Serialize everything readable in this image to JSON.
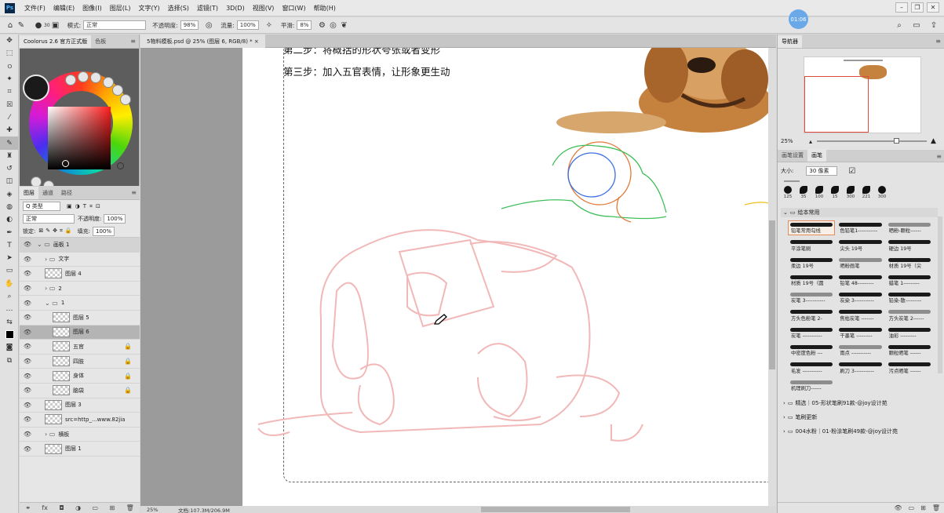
{
  "menu": {
    "logo": "Ps",
    "items": [
      "文件(F)",
      "编辑(E)",
      "图像(I)",
      "图层(L)",
      "文字(Y)",
      "选择(S)",
      "滤镜(T)",
      "3D(D)",
      "视图(V)",
      "窗口(W)",
      "帮助(H)"
    ]
  },
  "timer": "01:06",
  "options": {
    "brush_size": "30",
    "mode_label": "模式:",
    "mode_value": "正常",
    "opacity_label": "不透明度:",
    "opacity_value": "98%",
    "flow_label": "流量:",
    "flow_value": "100%",
    "smooth_label": "平滑:",
    "smooth_value": "8%"
  },
  "left_panel": {
    "tabs": [
      "Coolorus 2.6 官方正式版",
      "色板"
    ],
    "layer_tabs": [
      "图层",
      "通道",
      "路径"
    ],
    "filter_kind": "Q 类型",
    "blend_mode": "正常",
    "opacity_label": "不透明度:",
    "opacity_value": "100%",
    "lock_label": "锁定:",
    "fill_label": "填充:",
    "fill_value": "100%",
    "layers": [
      {
        "name": "画板 1",
        "type": "artboard",
        "indent": 0
      },
      {
        "name": "文字",
        "type": "group",
        "indent": 1
      },
      {
        "name": "图层 4",
        "type": "layer",
        "indent": 1
      },
      {
        "name": "2",
        "type": "group",
        "indent": 1
      },
      {
        "name": "1",
        "type": "group-open",
        "indent": 1
      },
      {
        "name": "图层 5",
        "type": "layer",
        "indent": 2
      },
      {
        "name": "图层 6",
        "type": "layer",
        "indent": 2,
        "selected": true
      },
      {
        "name": "五官",
        "type": "layer",
        "indent": 2,
        "locked": true
      },
      {
        "name": "四肢",
        "type": "layer",
        "indent": 2,
        "locked": true
      },
      {
        "name": "身体",
        "type": "layer",
        "indent": 2,
        "locked": true
      },
      {
        "name": "脑袋",
        "type": "layer",
        "indent": 2,
        "locked": true
      },
      {
        "name": "图层 3",
        "type": "layer",
        "indent": 1
      },
      {
        "name": "src=http_...www.82jia",
        "type": "layer",
        "indent": 1
      },
      {
        "name": "横板",
        "type": "group",
        "indent": 1
      },
      {
        "name": "图层 1",
        "type": "layer",
        "indent": 1
      }
    ]
  },
  "document": {
    "tab_title": "5物料模板.psd @ 25% (图层 6, RGB/8) * ×",
    "step2_text": "第二步：将概括的形状夸张或者变形",
    "step3_text": "第三步：加入五官表情，让形象更生动",
    "zoom": "25%",
    "doc_info": "文档:107.3M/206.9M"
  },
  "right_panel": {
    "navigator_tab": "导航器",
    "nav_zoom": "25%",
    "brush_tabs": [
      "画笔设置",
      "画笔"
    ],
    "size_label": "大小:",
    "size_value": "30 像素",
    "presets": [
      "125",
      "35",
      "100",
      "15",
      "300",
      "221",
      "300"
    ],
    "group_name": "绘本常用",
    "brushes": [
      "铅笔常用勾线",
      "色铅笔1-----------",
      "晒粉-颗粒------",
      "平涂笔刷",
      "尖头 19号",
      "硬边 19号",
      "柔边 19号",
      "晒粉画笔",
      "材质 19号（尖",
      "材质 19号（圆",
      "铅笔 48---------",
      "蜡笔 1---------",
      "炭笔 3-----------",
      "炭染 3-----------",
      "铅染-散---------",
      "方头色粉笔 2-",
      "焦枯炭笔 -------",
      "方头炭笔 2------",
      "炭笔 -----------",
      "干墨笔 ---------",
      "油彩 ---------",
      "中密度色粉 ---",
      "雨点 -----------",
      "颗粒晒笔 ------",
      "毛发 -----------",
      "刷刀 3-----------",
      "污点晒笔 ------",
      "机理刷刀------"
    ],
    "folders": [
      "精选｜05-形状笔刷91款-@joy设计苑",
      "笔刷更新",
      "004水粉｜01-粉涂笔刷49款-@joy设计苑"
    ]
  },
  "colors": {
    "accent": "#e14a3c",
    "sketch_pink": "#f2b8b8",
    "selected_brush_border": "#e18c5a"
  }
}
